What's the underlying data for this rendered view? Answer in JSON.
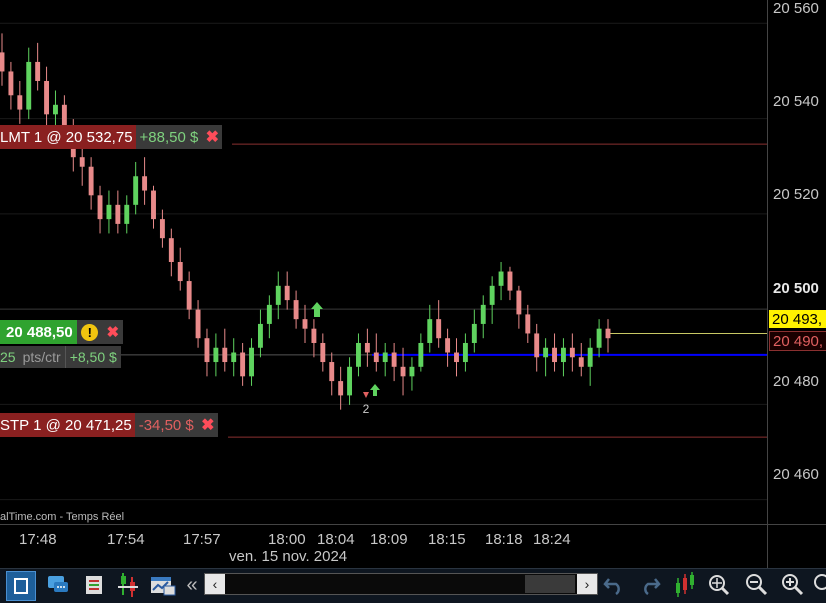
{
  "y_axis": {
    "labels": [
      "20 560",
      "20 540",
      "20 520",
      "20 500",
      "20 480",
      "20 460"
    ],
    "bold_label": "20 500"
  },
  "x_axis": {
    "labels": [
      "17:48",
      "17:54",
      "17:57",
      "18:00",
      "18:04",
      "18:09",
      "18:15",
      "18:18",
      "18:24"
    ],
    "date": "ven. 15 nov. 2024"
  },
  "watermark": "alTime.com - Temps Réel",
  "orders": {
    "limit": {
      "label": "LMT 1 @ 20 532,75",
      "pl": "+88,50 $"
    },
    "stop": {
      "label": "STP 1 @ 20 471,25",
      "pl": "-34,50 $"
    }
  },
  "position": {
    "price": "20 488,50",
    "pts_value": "25",
    "pts_unit": "pts/ctr",
    "pl": "+8,50 $"
  },
  "price_tags": {
    "last": "20 493,",
    "entry": "20 490,"
  },
  "trade_marker": "2",
  "colors": {
    "bull": "#5fd35f",
    "bear": "#e88a8a",
    "entry_line": "#0000ff",
    "limit_line": "#8a3030",
    "last_line": "#c8c864"
  },
  "icons": [
    "select-icon",
    "chat-icon",
    "orders-icon",
    "strategy-icon",
    "chart-window-icon",
    "collapse-icon",
    "undo-icon",
    "redo-icon",
    "indicators-icon",
    "zoom-fit-icon",
    "zoom-out-icon",
    "zoom-in-icon"
  ],
  "chart_data": {
    "type": "candlestick",
    "ylim": [
      20453,
      20563
    ],
    "candles": [
      {
        "o": 20552,
        "h": 20556,
        "l": 20545,
        "c": 20548
      },
      {
        "o": 20548,
        "h": 20550,
        "l": 20540,
        "c": 20543
      },
      {
        "o": 20543,
        "h": 20546,
        "l": 20537,
        "c": 20540
      },
      {
        "o": 20540,
        "h": 20553,
        "l": 20538,
        "c": 20550
      },
      {
        "o": 20550,
        "h": 20554,
        "l": 20544,
        "c": 20546
      },
      {
        "o": 20546,
        "h": 20549,
        "l": 20536,
        "c": 20539
      },
      {
        "o": 20539,
        "h": 20544,
        "l": 20535,
        "c": 20541
      },
      {
        "o": 20541,
        "h": 20543,
        "l": 20532,
        "c": 20535
      },
      {
        "o": 20535,
        "h": 20538,
        "l": 20527,
        "c": 20530
      },
      {
        "o": 20530,
        "h": 20533,
        "l": 20524,
        "c": 20528
      },
      {
        "o": 20528,
        "h": 20530,
        "l": 20519,
        "c": 20522
      },
      {
        "o": 20522,
        "h": 20524,
        "l": 20514,
        "c": 20517
      },
      {
        "o": 20517,
        "h": 20523,
        "l": 20514,
        "c": 20520
      },
      {
        "o": 20520,
        "h": 20523,
        "l": 20514,
        "c": 20516
      },
      {
        "o": 20516,
        "h": 20522,
        "l": 20514,
        "c": 20520
      },
      {
        "o": 20520,
        "h": 20529,
        "l": 20518,
        "c": 20526
      },
      {
        "o": 20526,
        "h": 20530,
        "l": 20520,
        "c": 20523
      },
      {
        "o": 20523,
        "h": 20524,
        "l": 20515,
        "c": 20517
      },
      {
        "o": 20517,
        "h": 20519,
        "l": 20511,
        "c": 20513
      },
      {
        "o": 20513,
        "h": 20515,
        "l": 20505,
        "c": 20508
      },
      {
        "o": 20508,
        "h": 20511,
        "l": 20502,
        "c": 20504
      },
      {
        "o": 20504,
        "h": 20506,
        "l": 20496,
        "c": 20498
      },
      {
        "o": 20498,
        "h": 20500,
        "l": 20490,
        "c": 20492
      },
      {
        "o": 20492,
        "h": 20494,
        "l": 20484,
        "c": 20487
      },
      {
        "o": 20487,
        "h": 20493,
        "l": 20484,
        "c": 20490
      },
      {
        "o": 20490,
        "h": 20494,
        "l": 20485,
        "c": 20487
      },
      {
        "o": 20487,
        "h": 20492,
        "l": 20484,
        "c": 20489
      },
      {
        "o": 20489,
        "h": 20491,
        "l": 20482,
        "c": 20484
      },
      {
        "o": 20484,
        "h": 20492,
        "l": 20482,
        "c": 20490
      },
      {
        "o": 20490,
        "h": 20498,
        "l": 20488,
        "c": 20495
      },
      {
        "o": 20495,
        "h": 20501,
        "l": 20492,
        "c": 20499
      },
      {
        "o": 20499,
        "h": 20506,
        "l": 20496,
        "c": 20503
      },
      {
        "o": 20503,
        "h": 20506,
        "l": 20498,
        "c": 20500
      },
      {
        "o": 20500,
        "h": 20502,
        "l": 20494,
        "c": 20496
      },
      {
        "o": 20496,
        "h": 20499,
        "l": 20491,
        "c": 20494
      },
      {
        "o": 20494,
        "h": 20496,
        "l": 20488,
        "c": 20491
      },
      {
        "o": 20491,
        "h": 20493,
        "l": 20485,
        "c": 20487
      },
      {
        "o": 20487,
        "h": 20489,
        "l": 20480,
        "c": 20483
      },
      {
        "o": 20483,
        "h": 20486,
        "l": 20477,
        "c": 20480
      },
      {
        "o": 20480,
        "h": 20488,
        "l": 20478,
        "c": 20486
      },
      {
        "o": 20486,
        "h": 20493,
        "l": 20484,
        "c": 20491
      },
      {
        "o": 20491,
        "h": 20494,
        "l": 20486,
        "c": 20489
      },
      {
        "o": 20489,
        "h": 20493,
        "l": 20485,
        "c": 20487
      },
      {
        "o": 20487,
        "h": 20491,
        "l": 20484,
        "c": 20489
      },
      {
        "o": 20489,
        "h": 20491,
        "l": 20483,
        "c": 20486
      },
      {
        "o": 20486,
        "h": 20490,
        "l": 20480,
        "c": 20484
      },
      {
        "o": 20484,
        "h": 20488,
        "l": 20481,
        "c": 20486
      },
      {
        "o": 20486,
        "h": 20493,
        "l": 20485,
        "c": 20491
      },
      {
        "o": 20491,
        "h": 20499,
        "l": 20489,
        "c": 20496
      },
      {
        "o": 20496,
        "h": 20500,
        "l": 20490,
        "c": 20492
      },
      {
        "o": 20492,
        "h": 20494,
        "l": 20486,
        "c": 20489
      },
      {
        "o": 20489,
        "h": 20492,
        "l": 20484,
        "c": 20487
      },
      {
        "o": 20487,
        "h": 20493,
        "l": 20485,
        "c": 20491
      },
      {
        "o": 20491,
        "h": 20498,
        "l": 20489,
        "c": 20495
      },
      {
        "o": 20495,
        "h": 20501,
        "l": 20492,
        "c": 20499
      },
      {
        "o": 20499,
        "h": 20505,
        "l": 20495,
        "c": 20503
      },
      {
        "o": 20503,
        "h": 20508,
        "l": 20500,
        "c": 20506
      },
      {
        "o": 20506,
        "h": 20507,
        "l": 20500,
        "c": 20502
      },
      {
        "o": 20502,
        "h": 20503,
        "l": 20494,
        "c": 20497
      },
      {
        "o": 20497,
        "h": 20499,
        "l": 20491,
        "c": 20493
      },
      {
        "o": 20493,
        "h": 20495,
        "l": 20485,
        "c": 20488
      },
      {
        "o": 20488,
        "h": 20492,
        "l": 20484,
        "c": 20490
      },
      {
        "o": 20490,
        "h": 20493,
        "l": 20485,
        "c": 20487
      },
      {
        "o": 20487,
        "h": 20492,
        "l": 20484,
        "c": 20490
      },
      {
        "o": 20490,
        "h": 20493,
        "l": 20485,
        "c": 20488
      },
      {
        "o": 20488,
        "h": 20491,
        "l": 20484,
        "c": 20486
      },
      {
        "o": 20486,
        "h": 20492,
        "l": 20482,
        "c": 20490
      },
      {
        "o": 20490,
        "h": 20496,
        "l": 20488,
        "c": 20494
      },
      {
        "o": 20494,
        "h": 20496,
        "l": 20489,
        "c": 20492
      }
    ]
  }
}
